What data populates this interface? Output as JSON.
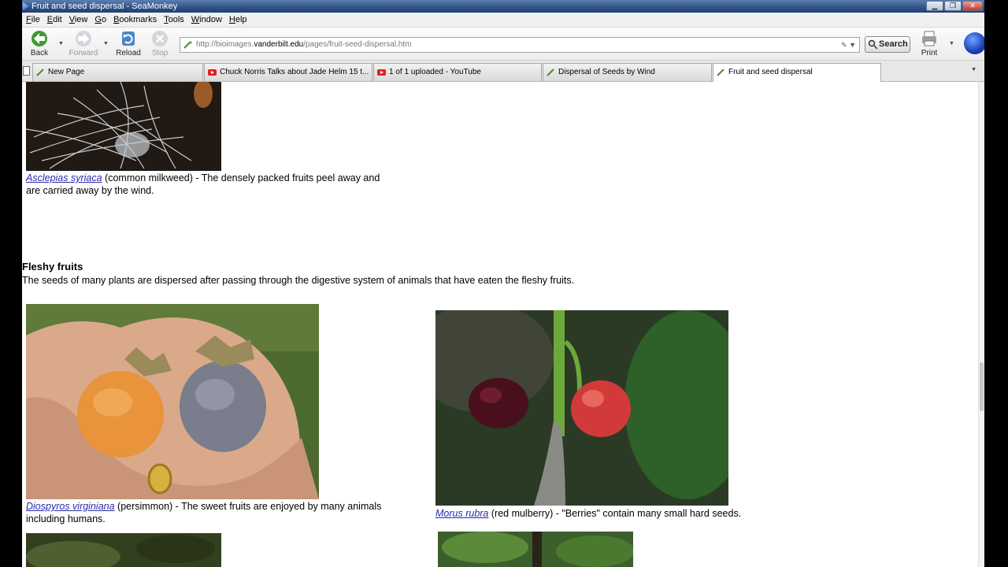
{
  "window": {
    "title": "Fruit and seed dispersal - SeaMonkey",
    "buttons": [
      "▁",
      "❐",
      "✕"
    ]
  },
  "menu": [
    "File",
    "Edit",
    "View",
    "Go",
    "Bookmarks",
    "Tools",
    "Window",
    "Help"
  ],
  "toolbar": {
    "back_label": "Back",
    "forward_label": "Forward",
    "reload_label": "Reload",
    "stop_label": "Stop",
    "search_label": "Search",
    "print_label": "Print"
  },
  "url": {
    "scheme": "http://bioimages.",
    "host": "vanderbilt.edu",
    "path": "/pages/fruit-seed-dispersal.htm"
  },
  "tabs": [
    {
      "label": "New Page",
      "icon": "page-icon",
      "active": false
    },
    {
      "label": "Chuck Norris Talks about Jade Helm 15 t...",
      "icon": "youtube-icon",
      "active": false
    },
    {
      "label": "1 of 1 uploaded - YouTube",
      "icon": "youtube-icon",
      "active": false
    },
    {
      "label": "Dispersal of Seeds by Wind",
      "icon": "page-icon",
      "active": false
    },
    {
      "label": "Fruit and seed dispersal",
      "icon": "page-icon",
      "active": true
    }
  ],
  "content": {
    "milkweed": {
      "name": "Asclepias syriaca",
      "rest": " (common milkweed) - The densely packed fruits peel away and are carried away by the wind."
    },
    "section": {
      "title": "Fleshy fruits",
      "text": "The seeds of many plants are dispersed after passing through the digestive system of animals that have eaten the fleshy fruits."
    },
    "persimmon": {
      "name": "Diospyros virginiana",
      "rest": " (persimmon) - The sweet fruits are enjoyed by many animals including humans."
    },
    "mulberry": {
      "name": "Morus rubra",
      "rest": " (red mulberry) - \"Berries\" contain many small hard seeds."
    }
  },
  "colors": {
    "link": "#2a2aa8",
    "titlebar": "#2f5387"
  }
}
